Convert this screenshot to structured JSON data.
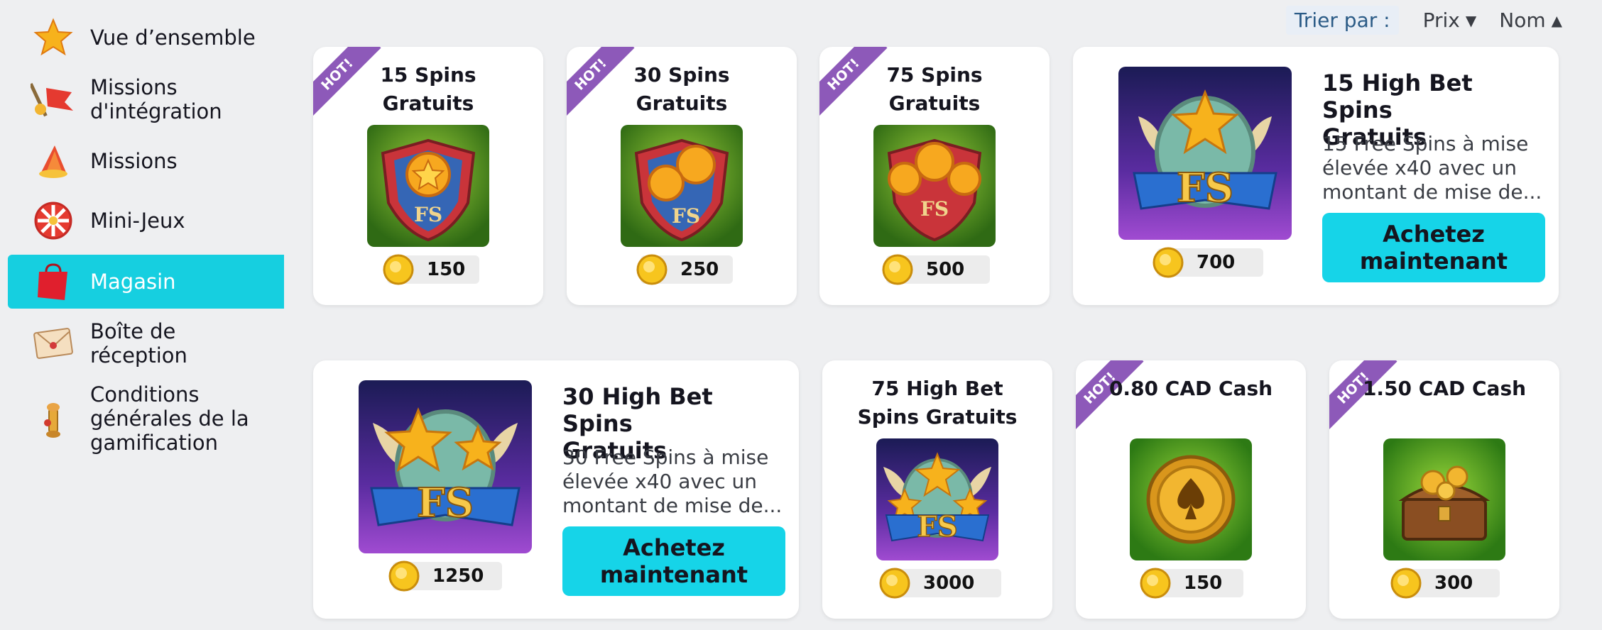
{
  "sidebar": {
    "items": [
      {
        "label": "Vue d’ensemble",
        "icon": "star-icon"
      },
      {
        "label": "Missions\nd'intégration",
        "icon": "flag-key-icon"
      },
      {
        "label": "Missions",
        "icon": "megaphone-icon"
      },
      {
        "label": "Mini-Jeux",
        "icon": "prize-wheel-icon"
      },
      {
        "label": "Magasin",
        "icon": "shopping-bag-icon",
        "active": true
      },
      {
        "label": "Boîte de\nréception",
        "icon": "envelope-icon"
      },
      {
        "label": "Conditions\ngénérales de la\ngamification",
        "icon": "scroll-quill-icon"
      }
    ]
  },
  "sort": {
    "label": "Trier par :",
    "options": [
      {
        "label": "Prix",
        "arrow": "▼"
      },
      {
        "label": "Nom",
        "arrow": "▲"
      }
    ]
  },
  "store": {
    "hot_label": "HOT!",
    "buy_label": "Achetez maintenant",
    "items": [
      {
        "title": "15 Spins\nGratuits",
        "price": "150",
        "hot": true
      },
      {
        "title": "30 Spins\nGratuits",
        "price": "250",
        "hot": true
      },
      {
        "title": "75 Spins\nGratuits",
        "price": "500",
        "hot": true
      },
      {
        "title": "15 High Bet Spins\nGratuits",
        "desc": "15 Free Spins à mise\nélevée x40 avec un\nmontant de mise de...",
        "price": "700"
      },
      {
        "title": "30 High Bet Spins\nGratuits",
        "desc": "30 Free Spins à mise\nélevée x40 avec un\nmontant de mise de...",
        "price": "1250"
      },
      {
        "title": "75 High Bet\nSpins Gratuits",
        "price": "3000"
      },
      {
        "title": "0.80 CAD Cash",
        "price": "150",
        "hot": true
      },
      {
        "title": "1.50 CAD Cash",
        "price": "300",
        "hot": true
      }
    ]
  },
  "colors": {
    "accent": "#16cfe0",
    "ribbon": "#8d59b9",
    "background": "#eeeff1"
  }
}
